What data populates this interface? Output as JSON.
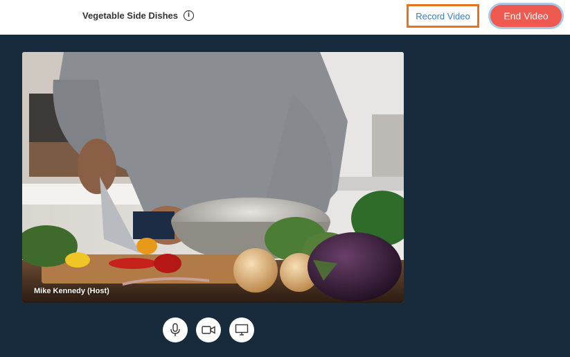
{
  "header": {
    "title": "Vegetable Side Dishes",
    "info_icon": "info-icon",
    "record_label": "Record Video",
    "end_label": "End Video"
  },
  "video": {
    "participant_label": "Mike Kennedy (Host)"
  },
  "controls": [
    {
      "icon": "microphone-icon"
    },
    {
      "icon": "camera-icon"
    },
    {
      "icon": "screen-share-icon"
    }
  ],
  "colors": {
    "background": "#172b3d",
    "record_highlight": "#e8711c",
    "record_text": "#3a7cc7",
    "end_button": "#ee5a4f"
  }
}
